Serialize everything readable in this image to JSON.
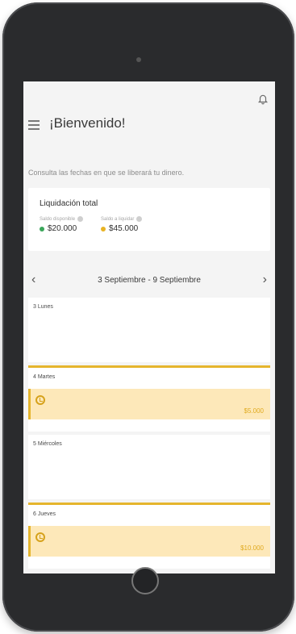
{
  "header": {
    "title": "¡Bienvenido!",
    "subtitle": "Consulta las fechas en que se liberará tu dinero."
  },
  "summary": {
    "title": "Liquidación total",
    "available_label": "Saldo disponible",
    "available_value": "$20.000",
    "pending_label": "Saldo a liquidar",
    "pending_value": "$45.000"
  },
  "week": {
    "range": "3 Septiembre - 9 Septiembre"
  },
  "days": [
    {
      "label": "3 Lunes",
      "has_release": false,
      "amount": ""
    },
    {
      "label": "4 Martes",
      "has_release": true,
      "amount": "$5.000"
    },
    {
      "label": "5 Miércoles",
      "has_release": false,
      "amount": ""
    },
    {
      "label": "6 Jueves",
      "has_release": true,
      "amount": "$10.000"
    }
  ],
  "colors": {
    "accent": "#e5b52d",
    "accent_light": "#fde8b9",
    "available_dot": "#3aa65a",
    "pending_dot": "#e8b324"
  },
  "icons": {
    "menu": "hamburger-icon",
    "bell": "bell-icon",
    "info": "info-icon",
    "prev": "chevron-left-icon",
    "next": "chevron-right-icon",
    "release": "clock-icon"
  }
}
